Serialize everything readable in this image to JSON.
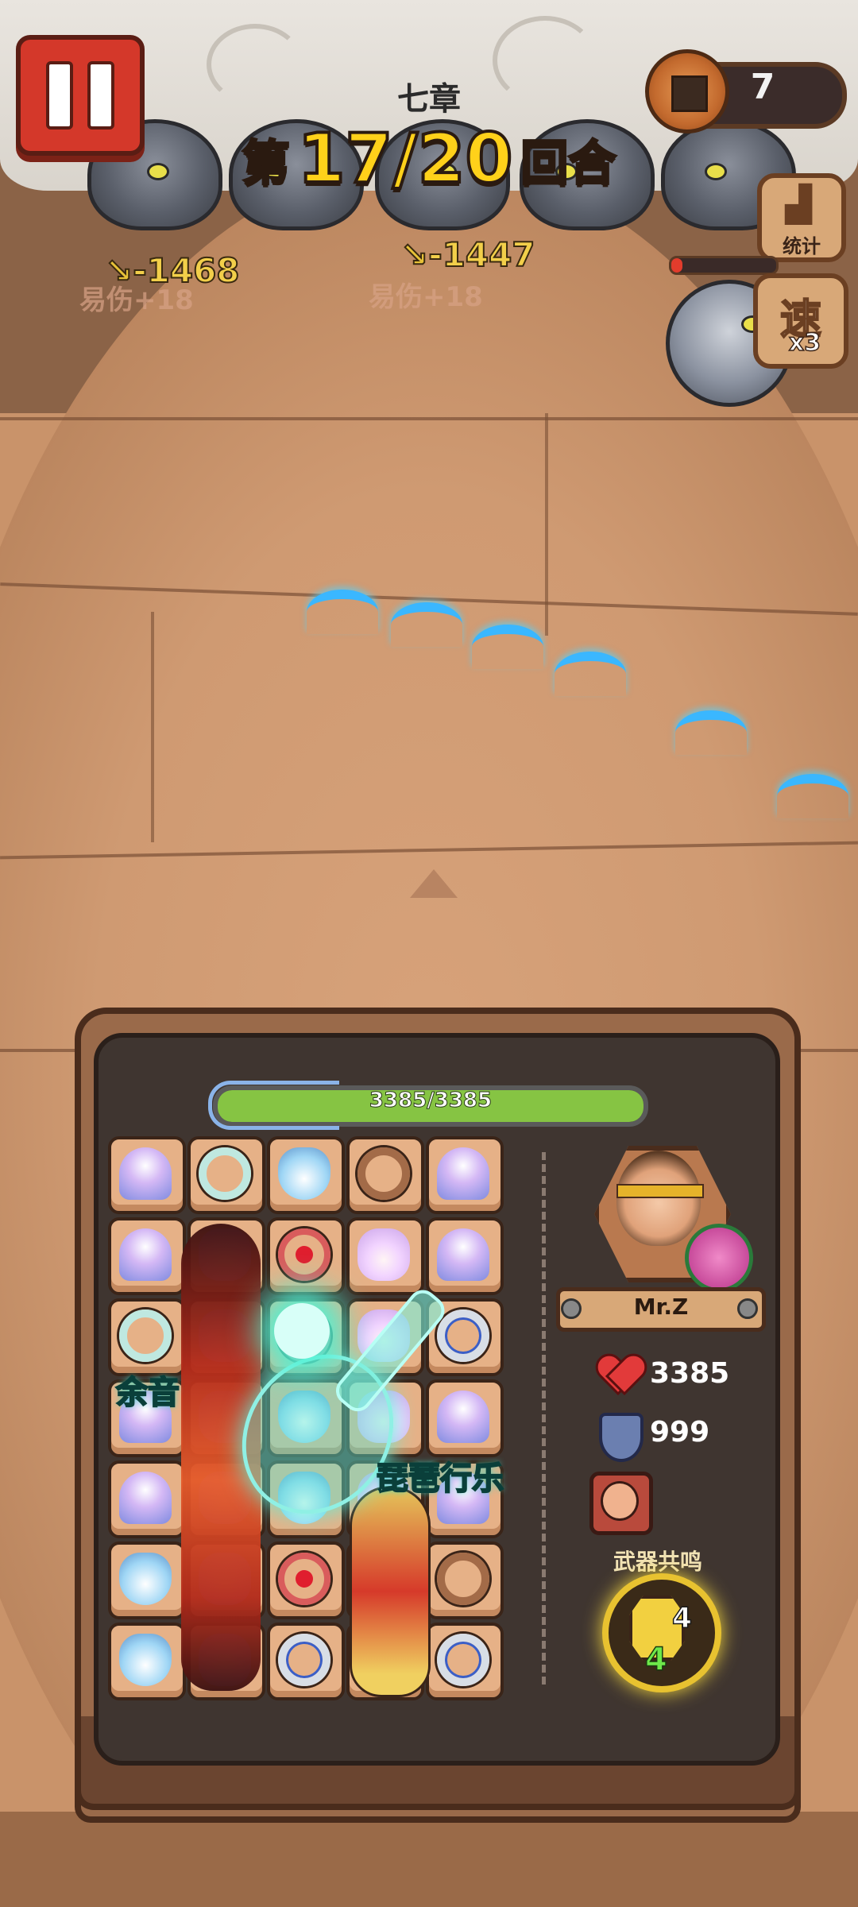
{
  "header": {
    "chapter": "七章",
    "round_prefix": "第",
    "round_current": 17,
    "round_total": 20,
    "round_text": "17/20",
    "round_suffix": "回合",
    "coins": "7"
  },
  "enemies": [
    {
      "damage": "-1468",
      "debuff": "易伤+18"
    },
    {
      "damage": "-1447",
      "debuff": "易伤+18"
    }
  ],
  "side_buttons": {
    "stats_label": "统计",
    "speed_label": "速",
    "speed_multiplier": "x3"
  },
  "player": {
    "hp_text": "3385/3385",
    "hp_fraction": 1.0,
    "name": "Mr.Z",
    "health": "3385",
    "armor": "999"
  },
  "skill_popups": {
    "left": "余音",
    "right": "琵琶行乐"
  },
  "resonance": {
    "label": "武器共鸣",
    "count": "4",
    "level": "4"
  },
  "grid_items": [
    [
      "lotus-lamp",
      "jade-bracelet",
      "spirit-pouch",
      "wooden-bracelet",
      "lotus-lamp"
    ],
    [
      "lotus-lamp",
      "fire-pipa",
      "ruby-ring",
      "fire-pipa",
      "lotus-lamp"
    ],
    [
      "jade-bracelet",
      "fire-pipa",
      "ruby-ring",
      "fire-pipa",
      "silver-bracelet"
    ],
    [
      "lotus-lamp",
      "fire-pipa",
      "spirit-pouch",
      "fire-pipa",
      "lotus-lamp"
    ],
    [
      "lotus-lamp",
      "fire-pipa",
      "spirit-pouch",
      "golden-pipa",
      "lotus-lamp"
    ],
    [
      "spirit-pouch",
      "fire-pipa",
      "ruby-ring",
      "golden-pipa",
      "wooden-bracelet"
    ],
    [
      "spirit-pouch",
      "fire-pipa",
      "silver-bracelet",
      "golden-pipa",
      "silver-bracelet"
    ]
  ],
  "colors": {
    "hp_fill": "#86c443",
    "pause": "#d4382a",
    "round_number": "#ffd11a"
  }
}
